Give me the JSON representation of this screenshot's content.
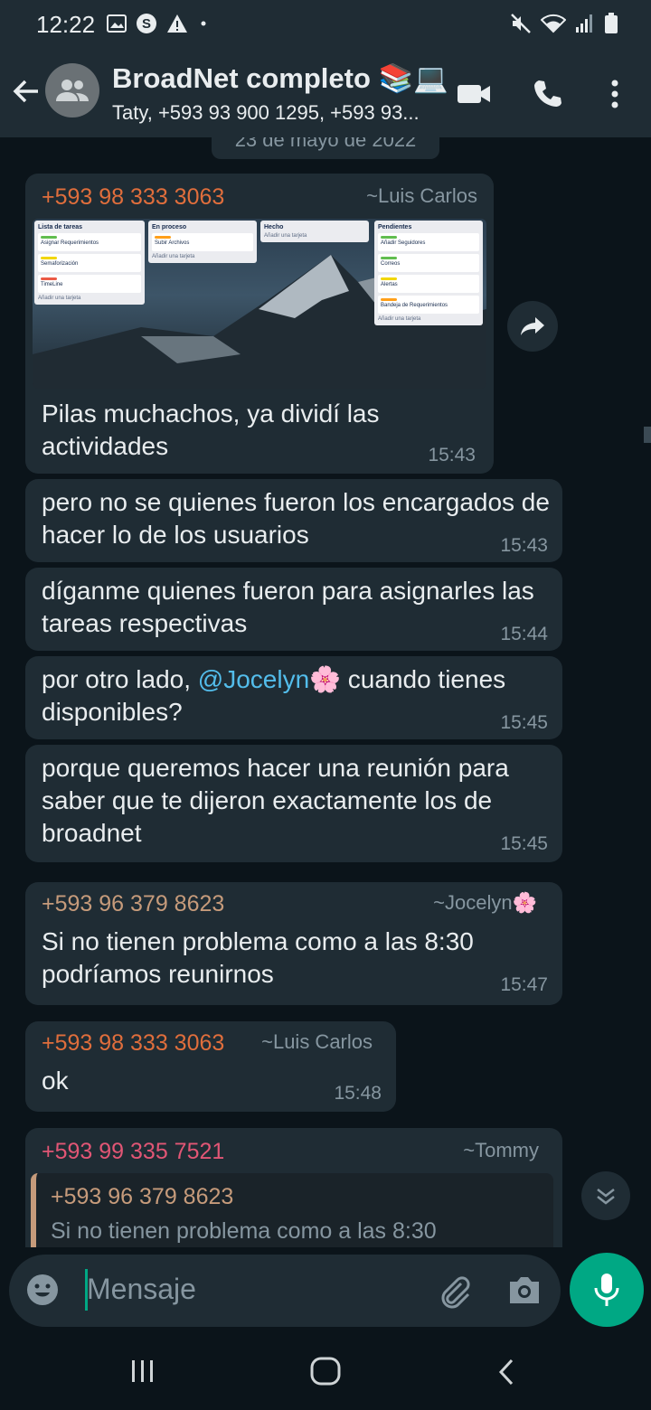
{
  "status_bar": {
    "time": "12:22"
  },
  "header": {
    "title": "BroadNet completo 📚💻",
    "subtitle": "Taty, +593 93 900 1295, +593 93..."
  },
  "date_chip": "23 de mayo de 2022",
  "image_board": {
    "lists": [
      {
        "title": "Lista de tareas",
        "cards": [
          "Asignar Requerimientos",
          "Semaforización",
          "TimeLine"
        ],
        "add": "Añadir una tarjeta"
      },
      {
        "title": "En proceso",
        "cards": [
          "Subir Archivos"
        ],
        "add": "Añadir una tarjeta"
      },
      {
        "title": "Hecho",
        "cards": [],
        "add": "Añadir una tarjeta"
      },
      {
        "title": "Pendientes",
        "cards": [
          "Añadir Seguidores",
          "Correos",
          "Alertas",
          "Bandeja de Requerimientos"
        ],
        "add": "Añadir una tarjeta"
      }
    ]
  },
  "messages": [
    {
      "sender": "+593 98 333 3063",
      "alias": "~Luis Carlos",
      "text": "Pilas muchachos, ya dividí las actividades",
      "time": "15:43",
      "sender_color": "#e06e3c"
    },
    {
      "text": "pero no se quienes fueron los encargados de hacer lo de los usuarios",
      "time": "15:43"
    },
    {
      "text": "díganme quienes fueron para asignarles las tareas respectivas",
      "time": "15:44"
    },
    {
      "text_before": "por otro lado, ",
      "mention": "@Jocelyn🌸",
      "text_after": " cuando tienes disponibles?",
      "time": "15:45"
    },
    {
      "text": "porque queremos hacer una reunión para saber que te dijeron exactamente los de broadnet",
      "time": "15:45"
    },
    {
      "sender": "+593 96 379 8623",
      "alias": "~Jocelyn🌸",
      "text": "Si no tienen problema como a las 8:30 podríamos reunirnos",
      "time": "15:47",
      "sender_color": "#c69b7b"
    },
    {
      "sender": "+593 98 333 3063",
      "alias": "~Luis Carlos",
      "text": "ok",
      "time": "15:48",
      "sender_color": "#e06e3c"
    },
    {
      "sender": "+593 99 335 7521",
      "alias": "~Tommy",
      "sender_color": "#e25675",
      "quote": {
        "sender": "+593 96 379 8623",
        "text": "Si no tienen problema como a las 8:30"
      }
    }
  ],
  "input": {
    "placeholder": "Mensaje"
  },
  "colors": {
    "accent": "#00a884",
    "bubble": "#1f2c34",
    "background": "#0b141a",
    "mention": "#53bdeb"
  }
}
